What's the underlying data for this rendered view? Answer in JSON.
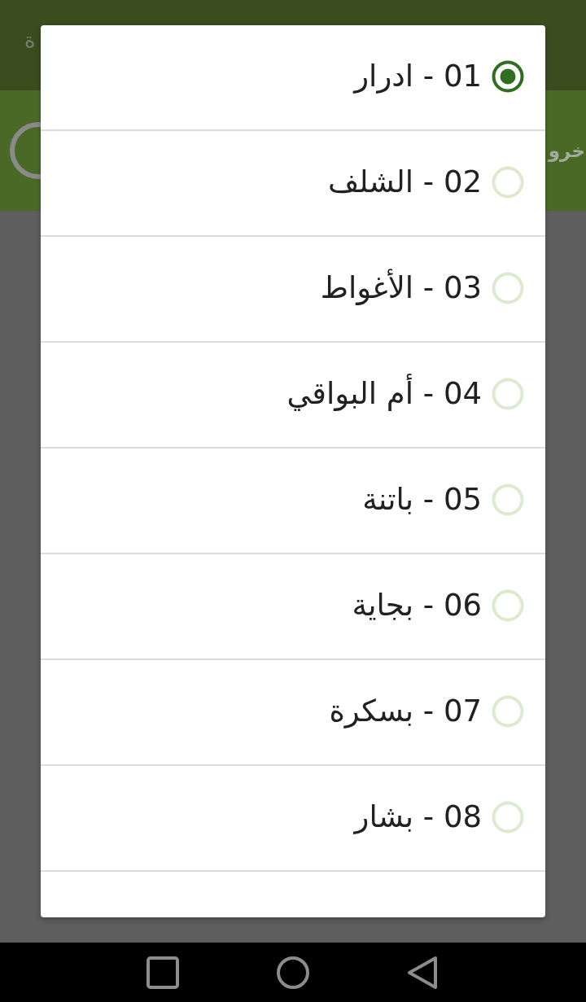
{
  "background": {
    "header_title": "ة",
    "toolbar_label": "خرو"
  },
  "dialog": {
    "options": [
      {
        "label": "01 - ادرار",
        "selected": true
      },
      {
        "label": "02 - الشلف",
        "selected": false
      },
      {
        "label": "03 - الأغواط",
        "selected": false
      },
      {
        "label": "04 - أم البواقي",
        "selected": false
      },
      {
        "label": "05 - باتنة",
        "selected": false
      },
      {
        "label": "06 - بجاية",
        "selected": false
      },
      {
        "label": "07 - بسكرة",
        "selected": false
      },
      {
        "label": "08 - بشار",
        "selected": false
      }
    ]
  }
}
